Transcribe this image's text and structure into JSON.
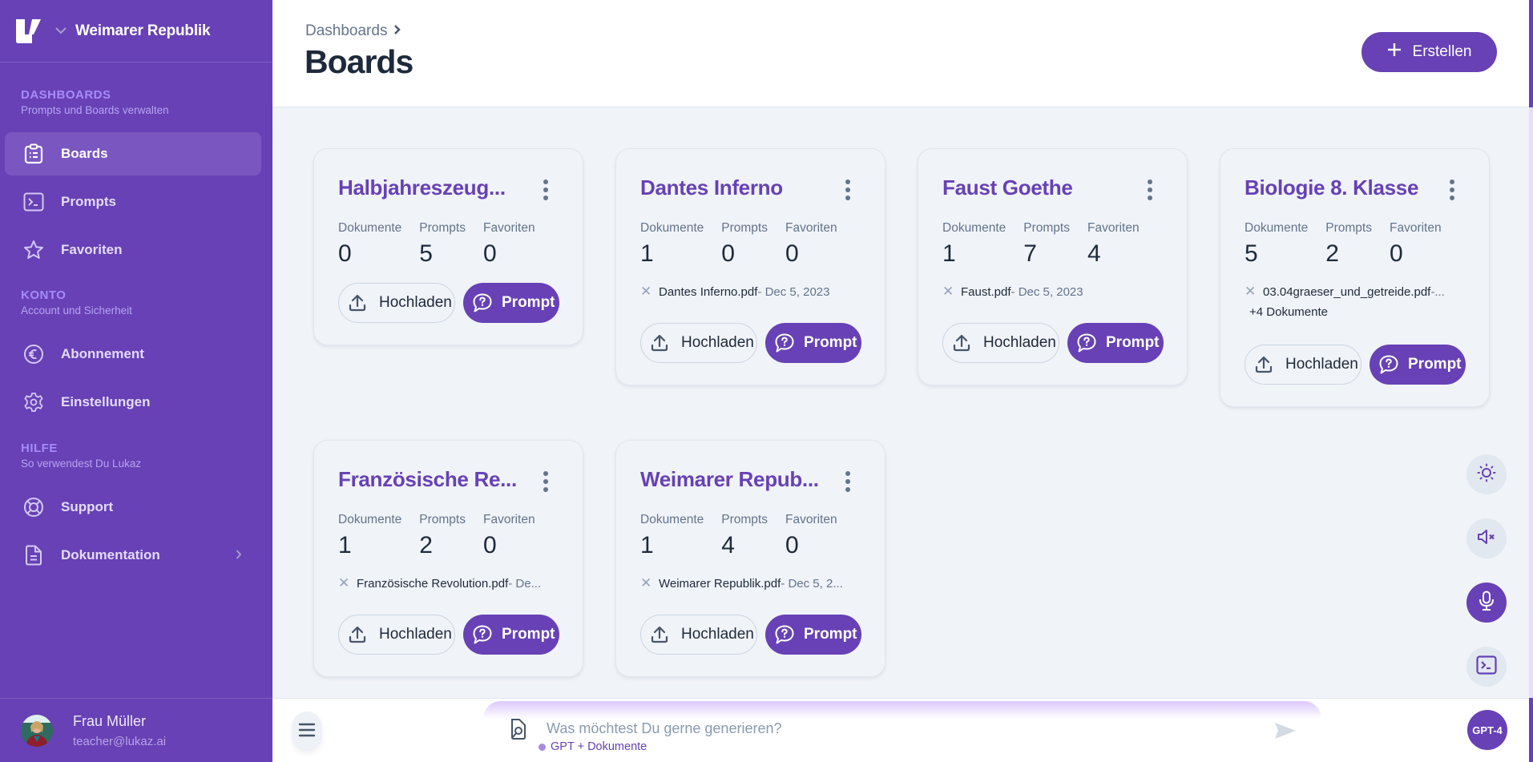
{
  "workspace": {
    "name": "Weimarer Republik",
    "logo": "lukaz-logo",
    "switch_icon": "chevron-down-icon"
  },
  "sidebar": {
    "sections": [
      {
        "heading": "DASHBOARDS",
        "subtitle": "Prompts und Boards verwalten"
      },
      {
        "heading": "KONTO",
        "subtitle": "Account und Sicherheit"
      },
      {
        "heading": "HILFE",
        "subtitle": "So verwendest Du Lukaz"
      }
    ],
    "items": [
      {
        "label": "Boards",
        "icon": "clipboard-list-icon",
        "active": true
      },
      {
        "label": "Prompts",
        "icon": "terminal-icon"
      },
      {
        "label": "Favoriten",
        "icon": "star-icon"
      },
      {
        "label": "Abonnement",
        "icon": "euro-icon"
      },
      {
        "label": "Einstellungen",
        "icon": "gear-icon"
      },
      {
        "label": "Support",
        "icon": "lifebuoy-icon"
      },
      {
        "label": "Dokumentation",
        "icon": "document-icon",
        "has_submenu": true
      }
    ],
    "user": {
      "name": "Frau Müller",
      "email": "teacher@lukaz.ai"
    }
  },
  "header": {
    "breadcrumb": "Dashboards",
    "title": "Boards",
    "create_label": "Erstellen"
  },
  "labels": {
    "documents": "Dokumente",
    "prompts": "Prompts",
    "favorites": "Favoriten",
    "upload": "Hochladen",
    "prompt": "Prompt"
  },
  "boards": [
    {
      "title": "Halbjahreszeug...",
      "documents": "0",
      "prompts": "5",
      "favorites": "0",
      "doc_file": null,
      "doc_date": null,
      "more_docs": null
    },
    {
      "title": "Dantes Inferno",
      "documents": "1",
      "prompts": "0",
      "favorites": "0",
      "doc_file": "Dantes Inferno.pdf",
      "doc_date": " - Dec 5, 2023",
      "more_docs": null
    },
    {
      "title": "Faust Goethe",
      "documents": "1",
      "prompts": "7",
      "favorites": "4",
      "doc_file": "Faust.pdf",
      "doc_date": " - Dec 5, 2023",
      "more_docs": null
    },
    {
      "title": "Biologie 8. Klasse",
      "documents": "5",
      "prompts": "2",
      "favorites": "0",
      "doc_file": "03.04graeser_und_getreide.pdf",
      "doc_date": " -...",
      "more_docs": "+4 Dokumente"
    },
    {
      "title": "Französische Re...",
      "documents": "1",
      "prompts": "2",
      "favorites": "0",
      "doc_file": "Französische Revolution.pdf",
      "doc_date": " - De...",
      "more_docs": null
    },
    {
      "title": "Weimarer Repub...",
      "documents": "1",
      "prompts": "4",
      "favorites": "0",
      "doc_file": "Weimarer Republik.pdf",
      "doc_date": " - Dec 5, 2...",
      "more_docs": null
    }
  ],
  "floating_controls": [
    {
      "name": "theme-toggle",
      "icon": "sun-icon"
    },
    {
      "name": "mute-toggle",
      "icon": "speaker-muted-icon"
    },
    {
      "name": "voice-input",
      "icon": "microphone-icon",
      "primary": true
    },
    {
      "name": "prompt-console",
      "icon": "terminal-icon"
    }
  ],
  "composer": {
    "placeholder": "Was möchtest Du gerne generieren?",
    "value": "",
    "mode": "GPT + Dokumente",
    "model": "GPT-4"
  },
  "colors": {
    "brand": "#6741b5",
    "background": "#f0f3f8",
    "muted_text": "#64748b"
  }
}
